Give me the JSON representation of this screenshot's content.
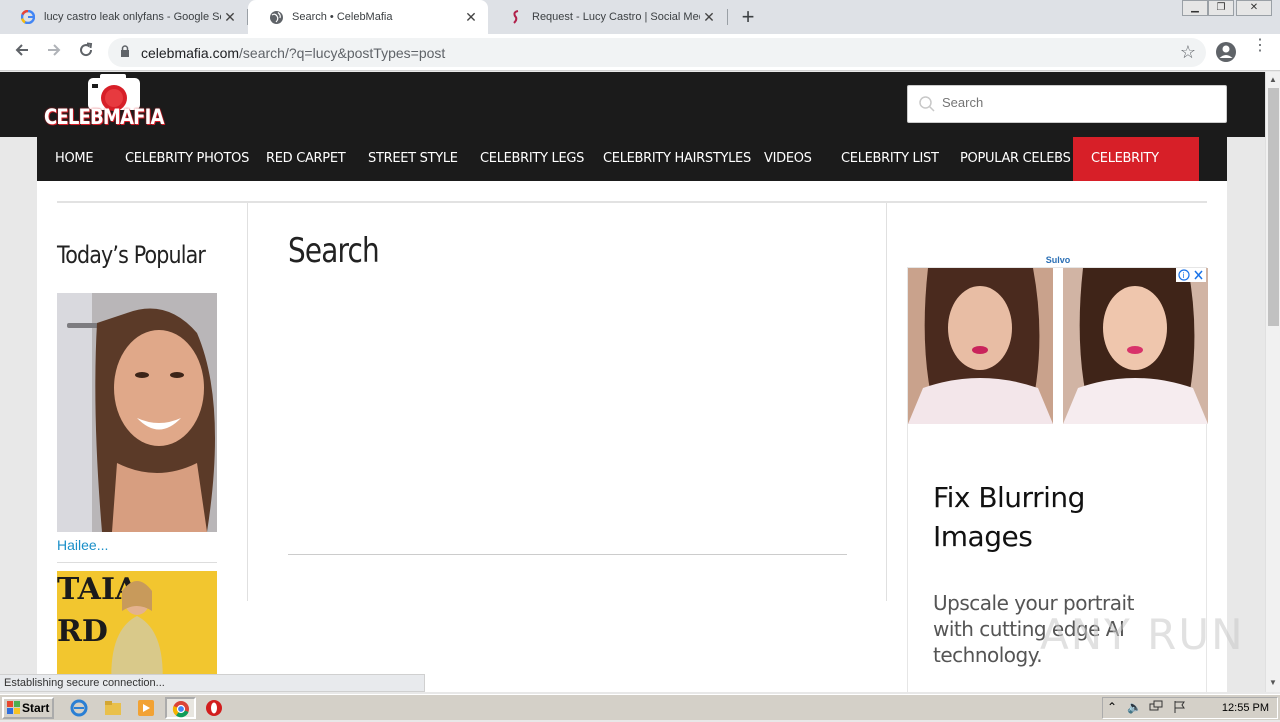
{
  "browser": {
    "tabs": [
      {
        "title": "lucy castro leak onlyfans - Google Se",
        "icon": "google-icon",
        "active": false
      },
      {
        "title": "Search • CelebMafia",
        "icon": "globe-icon",
        "active": true
      },
      {
        "title": "Request - Lucy Castro | Social Media",
        "icon": "site-icon",
        "active": false
      }
    ],
    "url_domain": "celebmafia.com",
    "url_path": "/search/?q=lucy&postTypes=post",
    "new_tab": "+"
  },
  "site": {
    "logo_text": "CELEBMAFIA",
    "search_placeholder": "Search",
    "menu": [
      "HOME",
      "CELEBRITY PHOTOS",
      "RED CARPET",
      "STREET STYLE",
      "CELEBRITY LEGS",
      "CELEBRITY HAIRSTYLES",
      "VIDEOS",
      "CELEBRITY LIST",
      "POPULAR CELEBS",
      "CELEBRITY STYLE"
    ],
    "sidebar_title": "Today’s Popular",
    "popular_caption": "Hailee...",
    "page_title": "Search"
  },
  "ad": {
    "brand": "Sulvo",
    "headline_1": "Fix Blurring",
    "headline_2": "Images",
    "body": "Upscale your portrait with cutting edge AI technology."
  },
  "status": "Establishing secure connection...",
  "watermark": "ANY RUN",
  "taskbar": {
    "start_label": "Start",
    "clock": "12:55 PM"
  }
}
